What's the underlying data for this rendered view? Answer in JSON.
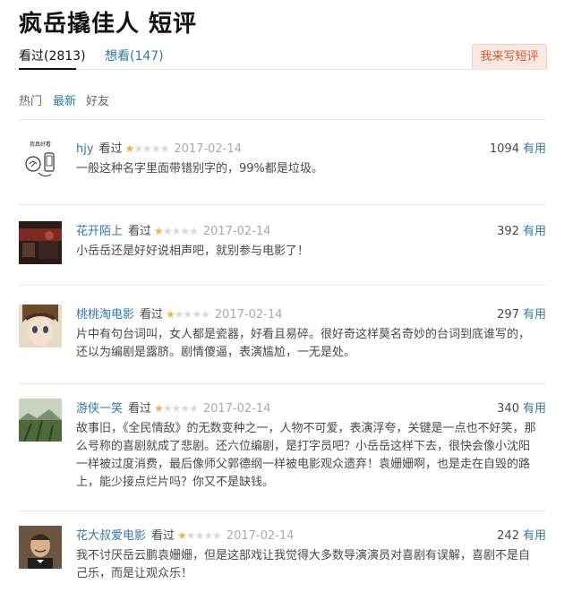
{
  "page": {
    "title": "疯岳撬佳人 短评"
  },
  "tabs": [
    {
      "label": "看过(2813)"
    },
    {
      "label": "想看(147)"
    }
  ],
  "write_button": {
    "label": "我来写短评"
  },
  "filters": [
    {
      "label": "热门"
    },
    {
      "label": "最新"
    },
    {
      "label": "好友"
    }
  ],
  "colors": {
    "link": "#3377aa",
    "star": "#f5b041",
    "button_bg": "#fde9e1",
    "button_text": "#c65a35"
  },
  "reviews": [
    {
      "user": "hjy",
      "status": "看过",
      "rating": 1,
      "rating_max": 5,
      "date": "2017-02-14",
      "votes": "1094",
      "useful_label": "有用",
      "avatar_caption": "我真好看",
      "avatar_icon": "hand-drawn-phone-avatar",
      "content": "一般这种名字里面带错别字的，99%都是垃圾。"
    },
    {
      "user": "花开陌上",
      "status": "看过",
      "rating": 1,
      "rating_max": 5,
      "date": "2017-02-14",
      "votes": "392",
      "useful_label": "有用",
      "avatar_icon": "photo-avatar",
      "content": "小岳岳还是好好说相声吧，就别参与电影了！"
    },
    {
      "user": "桃桃淘电影",
      "status": "看过",
      "rating": 1,
      "rating_max": 5,
      "date": "2017-02-14",
      "votes": "297",
      "useful_label": "有用",
      "avatar_icon": "anime-avatar",
      "content": "片中有句台词叫，女人都是瓷器，好看且易碎。很好奇这样莫名奇妙的台词到底谁写的，还以为编剧是露脐。剧情傻逼，表演尴尬，一无是处。"
    },
    {
      "user": "游侠一笑",
      "status": "看过",
      "rating": 1,
      "rating_max": 5,
      "date": "2017-02-14",
      "votes": "340",
      "useful_label": "有用",
      "avatar_icon": "landscape-avatar",
      "content": "故事旧，《全民情敌》的无数变种之一，人物不可爱，表演浮夸，关键是一点也不好笑，那么号称的喜剧就成了悲剧。还六位编剧，是打字员吧？小岳岳这样下去，很快会像小沈阳一样被过度消费，最后像师父郭德纲一样被电影观众遗弃！袁姗姗啊，也是走在自毁的路上，能少接点烂片吗？你又不是缺钱。"
    },
    {
      "user": "花大叔爱电影",
      "status": "看过",
      "rating": 1,
      "rating_max": 5,
      "date": "2017-02-14",
      "votes": "242",
      "useful_label": "有用",
      "avatar_icon": "portrait-avatar",
      "content": "我不讨厌岳云鹏袁姗姗，但是这部戏让我觉得大多数导演演员对喜剧有误解，喜剧不是自己乐，而是让观众乐！"
    }
  ]
}
